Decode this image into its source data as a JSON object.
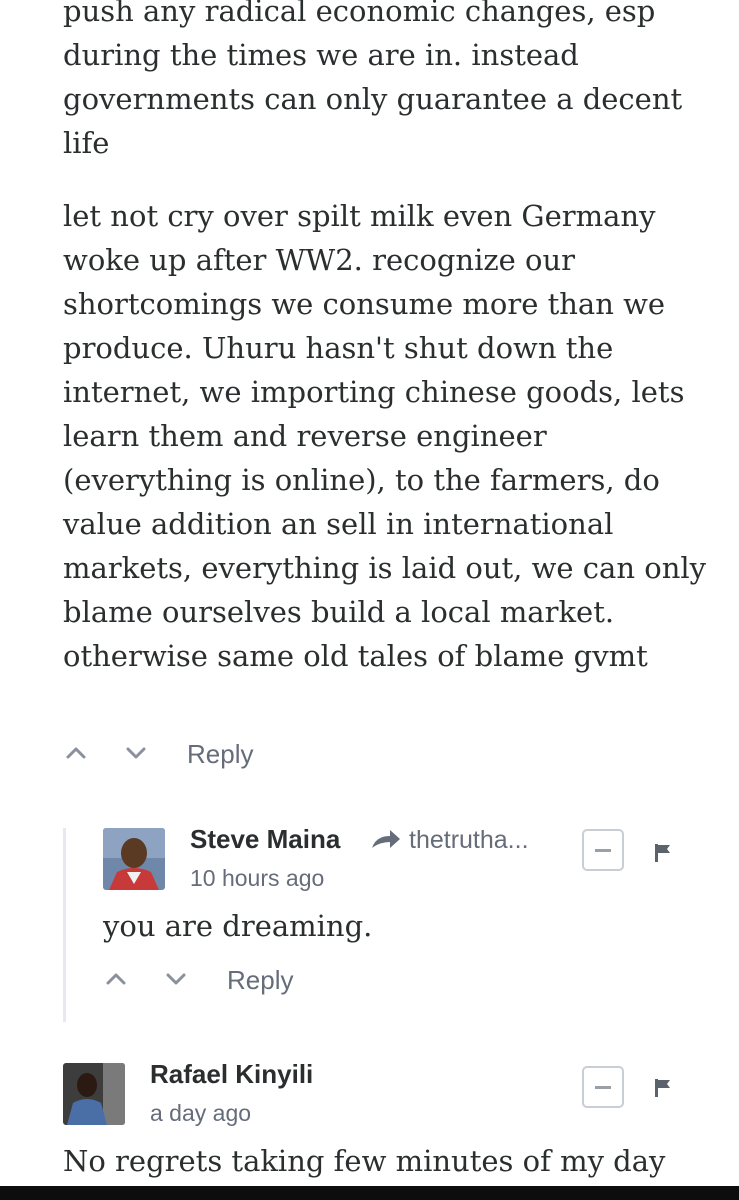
{
  "comment1": {
    "paragraphs": [
      "push any radical economic changes, esp during the times we are in. instead governments can only guarantee a decent life",
      "let not cry over spilt milk even Germany woke up after WW2. recognize our shortcomings we consume more than we produce. Uhuru hasn't shut down the internet, we importing chinese goods, lets learn them and reverse engineer (everything is online), to the farmers, do value addition an sell in international markets, everything is laid out, we can only blame ourselves build a local market. otherwise same old tales of blame gvmt"
    ],
    "reply_label": "Reply"
  },
  "comment2": {
    "author": "Steve Maina",
    "reply_to": "thetrutha...",
    "time": "10 hours ago",
    "text": "you are dreaming.",
    "reply_label": "Reply",
    "collapse_symbol": "−"
  },
  "comment3": {
    "author": "Rafael Kinyili",
    "time": "a day ago",
    "text": "No regrets taking few minutes of my day",
    "collapse_symbol": "−"
  },
  "icons": {
    "upvote": "chevron-up-icon",
    "downvote": "chevron-down-icon",
    "reply_to": "share-arrow-icon",
    "flag": "flag-icon"
  },
  "colors": {
    "text": "#2a2e2e",
    "muted": "#656c7a",
    "thread_bar": "#e7e9ee"
  }
}
